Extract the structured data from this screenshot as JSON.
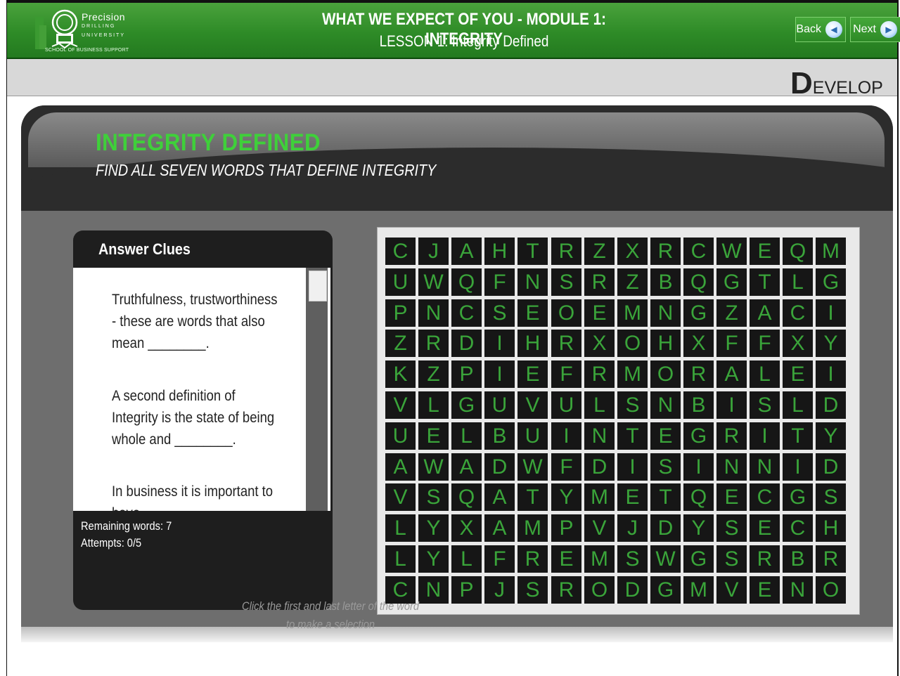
{
  "header": {
    "logo_name": "Precision",
    "logo_sub1": "DRILLING",
    "logo_sub2": "UNIVERSITY",
    "logo_school": "SCHOOL OF BUSINESS SUPPORT",
    "title": "WHAT WE EXPECT OF YOU - MODULE 1: INTEGRITY",
    "lesson": "LESSON 1: Integrity Defined",
    "back_label": "Back",
    "next_label": "Next"
  },
  "stage": {
    "first_letter": "D",
    "rest": "EVELOP"
  },
  "activity": {
    "title": "INTEGRITY DEFINED",
    "instruction": "FIND ALL SEVEN WORDS THAT DEFINE INTEGRITY"
  },
  "clues_panel": {
    "heading": "Answer Clues",
    "clues": [
      "Truthfulness, trustworthiness - these are words that also mean ________.",
      "A second definition of Integrity is the state of being whole and ________.",
      "In business it is important to have"
    ],
    "remaining": "Remaining words: 7",
    "attempts": "Attempts: 0/5"
  },
  "hint": "Click the first and last letter of the word to make a selection",
  "grid": [
    [
      "C",
      "J",
      "A",
      "H",
      "T",
      "R",
      "Z",
      "X",
      "R",
      "C",
      "W",
      "E",
      "Q",
      "M"
    ],
    [
      "U",
      "W",
      "Q",
      "F",
      "N",
      "S",
      "R",
      "Z",
      "B",
      "Q",
      "G",
      "T",
      "L",
      "G"
    ],
    [
      "P",
      "N",
      "C",
      "S",
      "E",
      "O",
      "E",
      "M",
      "N",
      "G",
      "Z",
      "A",
      "C",
      "I"
    ],
    [
      "Z",
      "R",
      "D",
      "I",
      "H",
      "R",
      "X",
      "O",
      "H",
      "X",
      "F",
      "F",
      "X",
      "Y"
    ],
    [
      "K",
      "Z",
      "P",
      "I",
      "E",
      "F",
      "R",
      "M",
      "O",
      "R",
      "A",
      "L",
      "E",
      "I"
    ],
    [
      "V",
      "L",
      "G",
      "U",
      "V",
      "U",
      "L",
      "S",
      "N",
      "B",
      "I",
      "S",
      "L",
      "D"
    ],
    [
      "U",
      "E",
      "L",
      "B",
      "U",
      "I",
      "N",
      "T",
      "E",
      "G",
      "R",
      "I",
      "T",
      "Y"
    ],
    [
      "A",
      "W",
      "A",
      "D",
      "W",
      "F",
      "D",
      "I",
      "S",
      "I",
      "N",
      "N",
      "I",
      "D"
    ],
    [
      "V",
      "S",
      "Q",
      "A",
      "T",
      "Y",
      "M",
      "E",
      "T",
      "Q",
      "E",
      "C",
      "G",
      "S"
    ],
    [
      "L",
      "Y",
      "X",
      "A",
      "M",
      "P",
      "V",
      "J",
      "D",
      "Y",
      "S",
      "E",
      "C",
      "H"
    ],
    [
      "L",
      "Y",
      "L",
      "F",
      "R",
      "E",
      "M",
      "S",
      "W",
      "G",
      "S",
      "R",
      "B",
      "R"
    ],
    [
      "C",
      "N",
      "P",
      "J",
      "S",
      "R",
      "O",
      "D",
      "G",
      "M",
      "V",
      "E",
      "N",
      "O"
    ]
  ],
  "colors": {
    "header_green": "#2e8b27",
    "title_green": "#3fd03a",
    "letter_green": "#3aa43a",
    "cell_bg": "#161616"
  }
}
